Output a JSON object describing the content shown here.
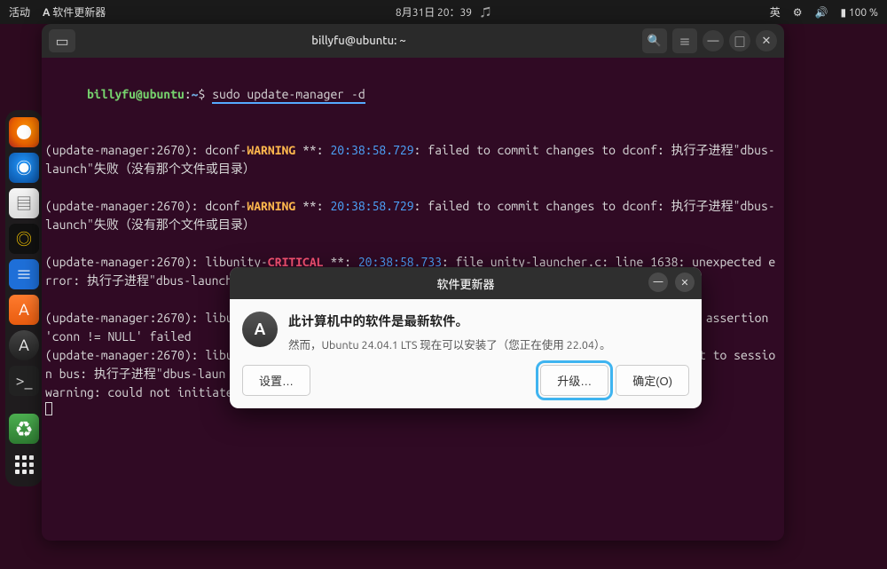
{
  "topbar": {
    "activities": "活动",
    "app_indicator": "软件更新器",
    "datetime": "8月31日 20：39",
    "input_method": "英",
    "battery": "100 %"
  },
  "terminal": {
    "title": "billyfu@ubuntu: ~",
    "prompt_user": "billyfu@ubuntu",
    "prompt_path": "~",
    "prompt_symbol": "$",
    "command": "sudo update-manager -d",
    "lines": [
      {
        "prefix": "(update-manager:2670): dconf-",
        "level": "WARNING",
        "mid": " **: ",
        "ts": "20:38:58.729",
        "rest": ": failed to commit changes to dconf: 执行子进程\"dbus-launch\"失败（没有那个文件或目录）"
      },
      {
        "prefix": "(update-manager:2670): dconf-",
        "level": "WARNING",
        "mid": " **: ",
        "ts": "20:38:58.729",
        "rest": ": failed to commit changes to dconf: 执行子进程\"dbus-launch\"失败（没有那个文件或目录）"
      },
      {
        "prefix": "(update-manager:2670): libunity-",
        "level": "CRITICAL",
        "mid": " **: ",
        "ts": "20:38:58.733",
        "rest": ": file unity-launcher.c: line 1638: unexpected error: 执行子进程\"dbus-launch\"失败（没有那个文件或目录） (g-exec-error-quark, 8)"
      },
      {
        "prefix": "(update-manager:2670): libun",
        "level": "",
        "mid": "",
        "ts": "",
        "rest": "                                                                 : assertion 'conn != NULL' failed"
      },
      {
        "prefix": "(update-manager:2670): libun",
        "level": "",
        "mid": "",
        "ts": "",
        "rest": "                                                                 ct to session bus: 执行子进程\"dbus-laun"
      },
      {
        "prefix": "warning: could not initiate ",
        "level": "",
        "mid": "",
        "ts": "",
        "rest": ""
      }
    ]
  },
  "dialog": {
    "title": "软件更新器",
    "heading": "此计算机中的软件是最新软件。",
    "subtext": "然而，Ubuntu 24.04.1 LTS 现在可以安装了（您正在使用 22.04）。",
    "settings_btn": "设置…",
    "upgrade_btn": "升级…",
    "ok_btn": "确定(O)"
  },
  "icons": {
    "updater": "A",
    "bell": "🔔",
    "network": "▲",
    "volume": "🔊",
    "power": "🔋",
    "search": "🔍",
    "menu": "≡",
    "minimize": "—",
    "maximize": "□",
    "close": "✕",
    "newtab": "⊞",
    "firefox": "🦊",
    "mail": "🔥",
    "files": "📁",
    "music": "◎",
    "doc": "📄",
    "store": "A",
    "terminal": ">_",
    "trash": "♻",
    "dialog_icon": "A"
  }
}
